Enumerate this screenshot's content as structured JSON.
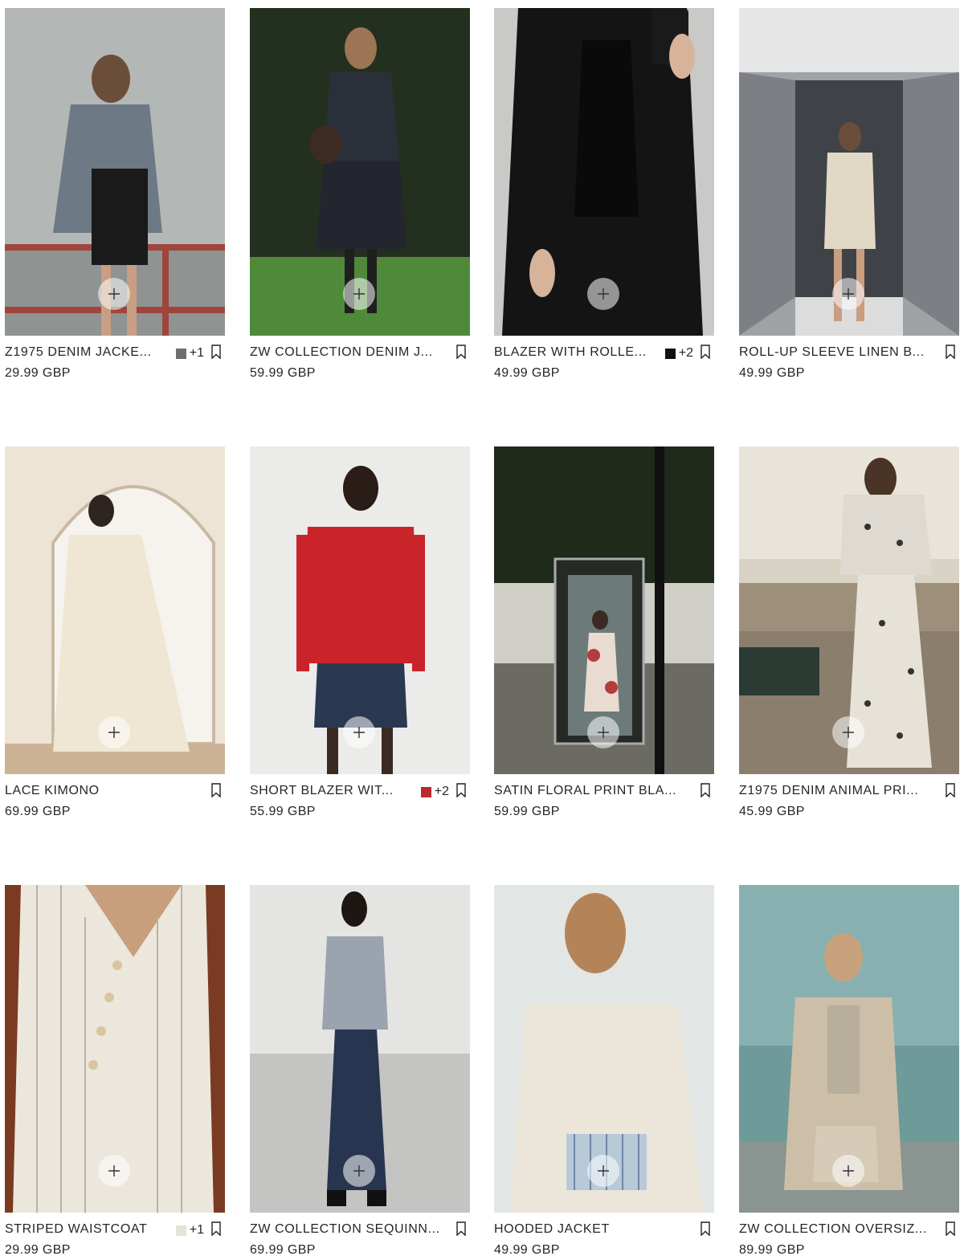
{
  "products": [
    {
      "name": "Z1975 DENIM JACKE...",
      "price": "29.99 GBP",
      "swatch_color": "#6e6e6e",
      "more_colors": "+1"
    },
    {
      "name": "ZW COLLECTION DENIM J...",
      "price": "59.99 GBP"
    },
    {
      "name": "BLAZER WITH ROLLE...",
      "price": "49.99 GBP",
      "swatch_color": "#111111",
      "more_colors": "+2"
    },
    {
      "name": "ROLL-UP SLEEVE LINEN B...",
      "price": "49.99 GBP"
    },
    {
      "name": "LACE KIMONO",
      "price": "69.99 GBP"
    },
    {
      "name": "SHORT BLAZER WIT...",
      "price": "55.99 GBP",
      "swatch_color": "#c0272d",
      "more_colors": "+2"
    },
    {
      "name": "SATIN FLORAL PRINT BLA...",
      "price": "59.99 GBP"
    },
    {
      "name": "Z1975 DENIM ANIMAL PRI...",
      "price": "45.99 GBP"
    },
    {
      "name": "STRIPED WAISTCOAT",
      "price": "29.99 GBP",
      "swatch_color": "#e6e2d6",
      "more_colors": "+1"
    },
    {
      "name": "ZW COLLECTION SEQUINN...",
      "price": "69.99 GBP"
    },
    {
      "name": "HOODED JACKET",
      "price": "49.99 GBP"
    },
    {
      "name": "ZW COLLECTION OVERSIZ...",
      "price": "89.99 GBP"
    }
  ],
  "icons": {
    "add": "plus-icon",
    "save": "bookmark-icon"
  }
}
